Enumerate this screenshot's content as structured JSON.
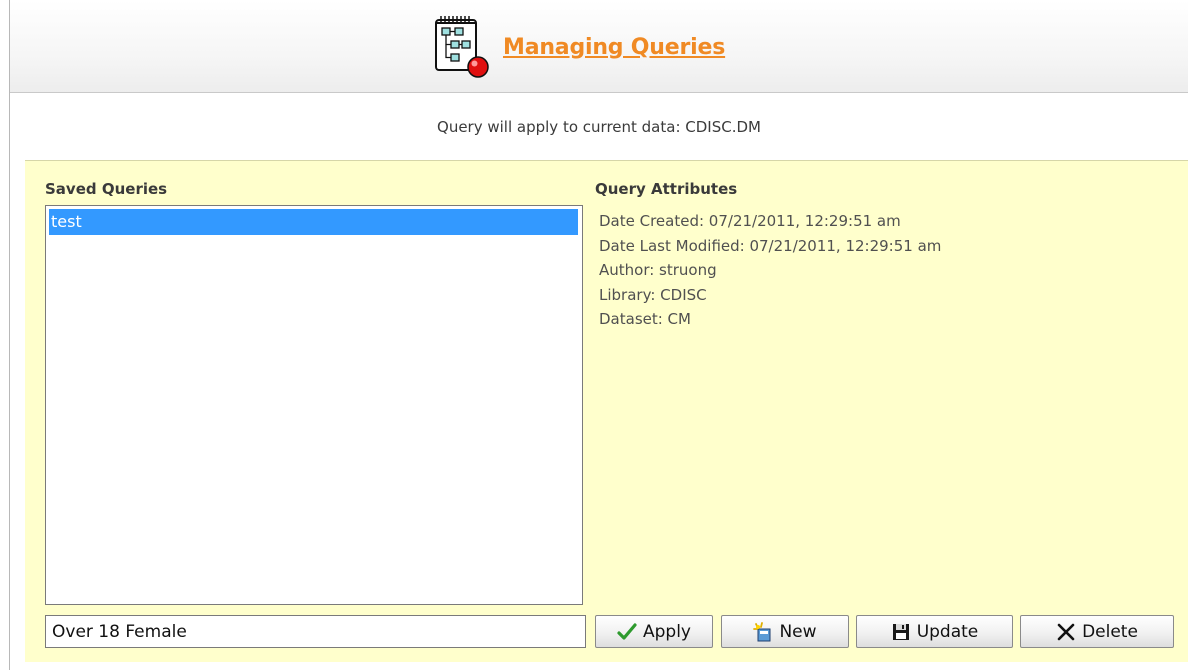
{
  "header": {
    "title": "Managing Queries"
  },
  "subtitle": "Query will apply to current data: CDISC.DM",
  "saved_queries": {
    "label": "Saved Queries",
    "items": [
      {
        "label": "test",
        "selected": true
      }
    ]
  },
  "query_attributes": {
    "label": "Query Attributes",
    "lines": [
      "Date Created: 07/21/2011, 12:29:51 am",
      "Date Last Modified: 07/21/2011, 12:29:51 am",
      "Author: struong",
      "Library: CDISC",
      "Dataset: CM"
    ]
  },
  "query_name": {
    "value": "Over 18 Female"
  },
  "buttons": {
    "apply": {
      "label": "Apply",
      "icon": "checkmark-icon"
    },
    "new": {
      "label": "New",
      "icon": "new-query-icon"
    },
    "update": {
      "label": "Update",
      "icon": "floppy-disk-icon"
    },
    "delete": {
      "label": "Delete",
      "icon": "x-icon"
    }
  },
  "colors": {
    "title": "#f08a24",
    "panel_background": "#ffffcc",
    "selection": "#3399ff",
    "apply_check": "#2e9a2e"
  }
}
